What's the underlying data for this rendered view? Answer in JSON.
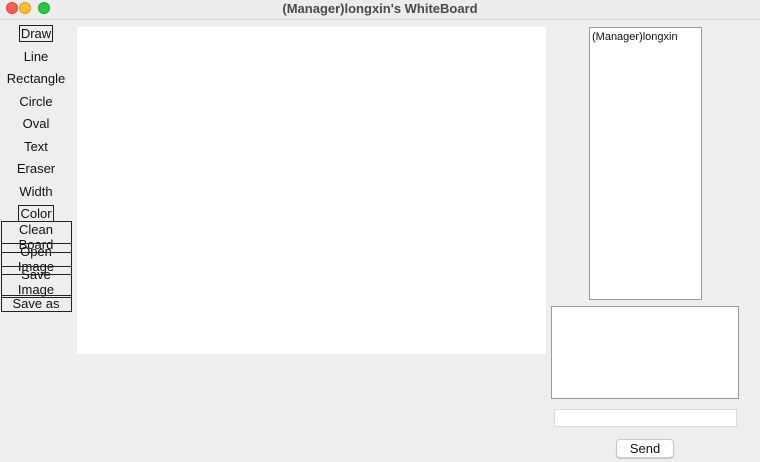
{
  "window": {
    "title": "(Manager)longxin's WhiteBoard"
  },
  "toolbar": {
    "tools": [
      {
        "label": "Draw"
      },
      {
        "label": "Line"
      },
      {
        "label": "Rectangle"
      },
      {
        "label": "Circle"
      },
      {
        "label": "Oval"
      },
      {
        "label": "Text"
      },
      {
        "label": "Eraser"
      },
      {
        "label": "Width"
      },
      {
        "label": "Color"
      },
      {
        "label": "Clean Board"
      },
      {
        "label": "Open Image"
      },
      {
        "label": "Save Image"
      },
      {
        "label": "Save as"
      }
    ]
  },
  "users": {
    "items": [
      "(Manager)longxin"
    ]
  },
  "chat": {
    "input_value": "",
    "send_label": "Send"
  },
  "colors": {
    "close": "#fe5f57",
    "minimize": "#febc2e",
    "maximize": "#28c840"
  }
}
